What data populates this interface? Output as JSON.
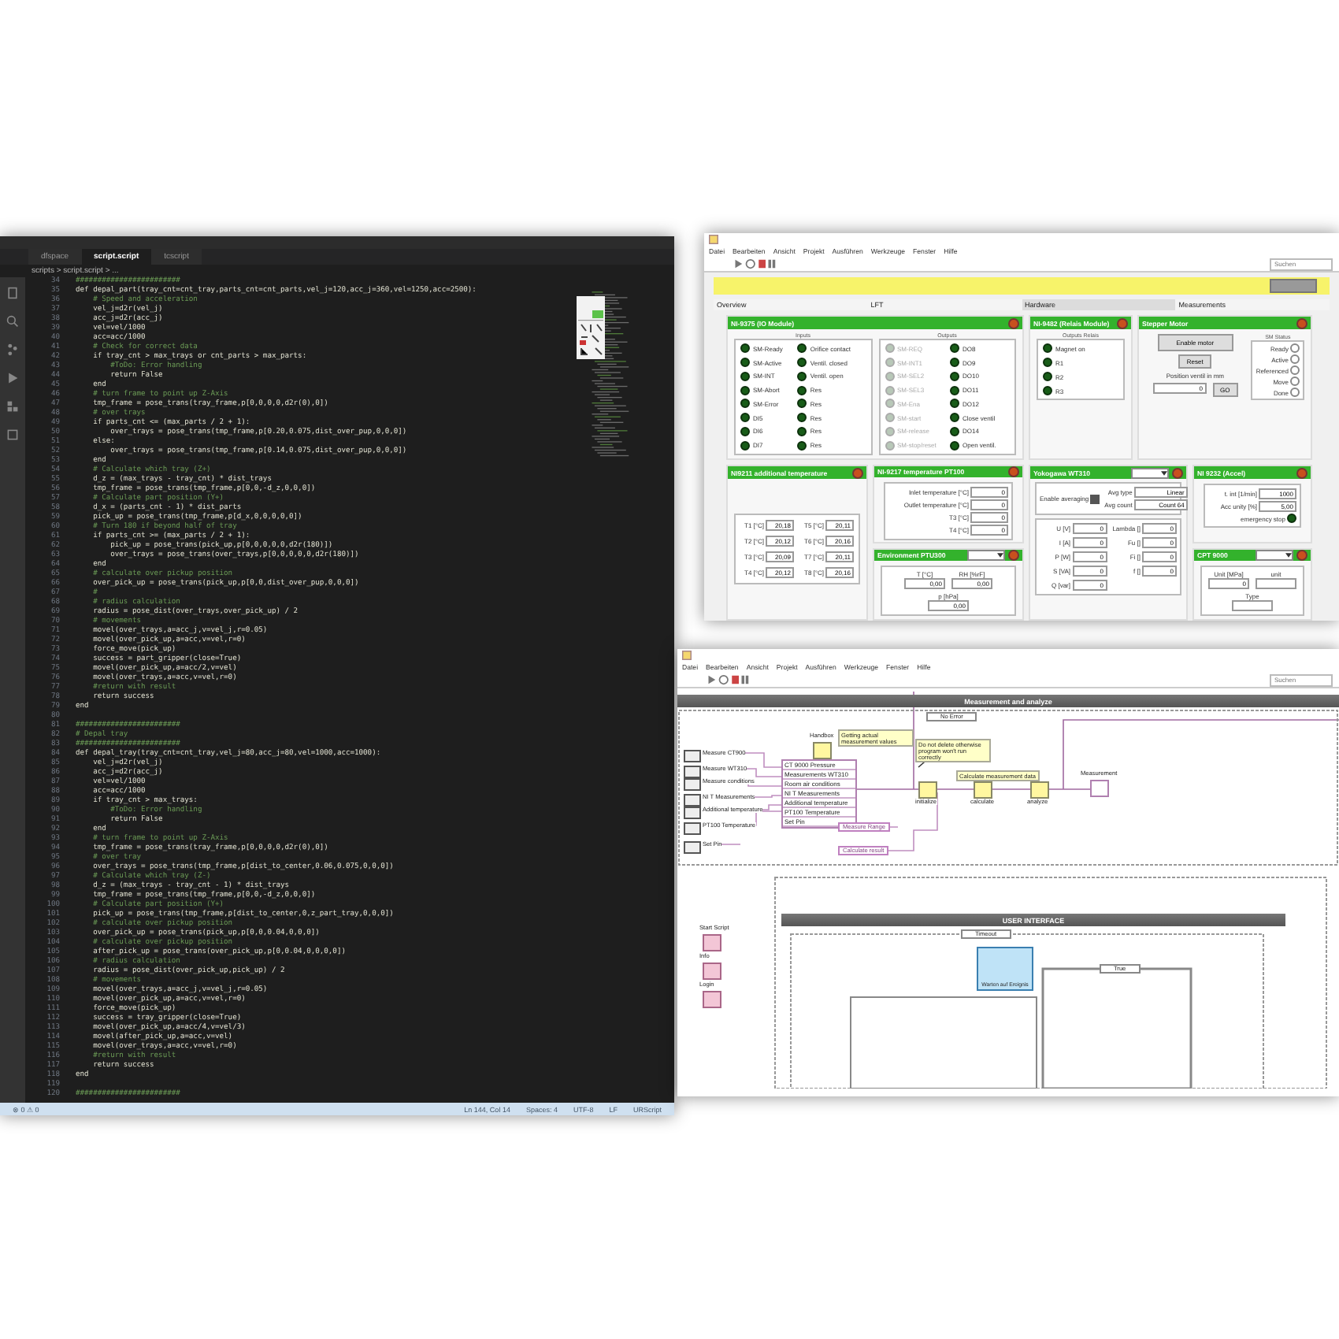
{
  "editor": {
    "tabs": [
      {
        "label": "dfspace",
        "selected": false
      },
      {
        "label": "script.script",
        "selected": true
      },
      {
        "label": "tcscript",
        "selected": false
      }
    ],
    "breadcrumb": "scripts > script.script > ...",
    "lines": [
      {
        "n": "34",
        "kind": "comment",
        "text": "########################"
      },
      {
        "n": "35",
        "kind": "code",
        "text": "def depal_part(tray_cnt=cnt_tray,parts_cnt=cnt_parts,vel_j=120,acc_j=360,vel=1250,acc=2500):"
      },
      {
        "n": "36",
        "kind": "comment",
        "text": "    # Speed and acceleration"
      },
      {
        "n": "37",
        "kind": "code",
        "text": "    vel_j=d2r(vel_j)"
      },
      {
        "n": "38",
        "kind": "code",
        "text": "    acc_j=d2r(acc_j)"
      },
      {
        "n": "39",
        "kind": "code",
        "text": "    vel=vel/1000"
      },
      {
        "n": "40",
        "kind": "code",
        "text": "    acc=acc/1000"
      },
      {
        "n": "41",
        "kind": "comment",
        "text": "    # Check for correct data"
      },
      {
        "n": "42",
        "kind": "code",
        "text": "    if tray_cnt > max_trays or cnt_parts > max_parts:"
      },
      {
        "n": "43",
        "kind": "comment",
        "text": "        #ToDo: Error handling"
      },
      {
        "n": "44",
        "kind": "code",
        "text": "        return False"
      },
      {
        "n": "45",
        "kind": "code",
        "text": "    end"
      },
      {
        "n": "46",
        "kind": "comment",
        "text": "    # turn frame to point up Z-Axis"
      },
      {
        "n": "47",
        "kind": "code",
        "text": "    tmp_frame = pose_trans(tray_frame,p[0,0,0,0,d2r(0),0])"
      },
      {
        "n": "48",
        "kind": "comment",
        "text": "    # over trays"
      },
      {
        "n": "49",
        "kind": "code",
        "text": "    if parts_cnt <= (max_parts / 2 + 1):"
      },
      {
        "n": "50",
        "kind": "code",
        "text": "        over_trays = pose_trans(tmp_frame,p[0.20,0.075,dist_over_pup,0,0,0])"
      },
      {
        "n": "51",
        "kind": "code",
        "text": "    else:"
      },
      {
        "n": "52",
        "kind": "code",
        "text": "        over_trays = pose_trans(tmp_frame,p[0.14,0.075,dist_over_pup,0,0,0])"
      },
      {
        "n": "53",
        "kind": "code",
        "text": "    end"
      },
      {
        "n": "54",
        "kind": "comment",
        "text": "    # Calculate which tray (Z+)"
      },
      {
        "n": "55",
        "kind": "code",
        "text": "    d_z = (max_trays - tray_cnt) * dist_trays"
      },
      {
        "n": "56",
        "kind": "code",
        "text": "    tmp_frame = pose_trans(tmp_frame,p[0,0,-d_z,0,0,0])"
      },
      {
        "n": "57",
        "kind": "comment",
        "text": "    # Calculate part position (Y+)"
      },
      {
        "n": "58",
        "kind": "code",
        "text": "    d_x = (parts_cnt - 1) * dist_parts"
      },
      {
        "n": "59",
        "kind": "code",
        "text": "    pick_up = pose_trans(tmp_frame,p[d_x,0,0,0,0,0])"
      },
      {
        "n": "60",
        "kind": "comment",
        "text": "    # Turn 180 if beyond half of tray"
      },
      {
        "n": "61",
        "kind": "code",
        "text": "    if parts_cnt >= (max_parts / 2 + 1):"
      },
      {
        "n": "62",
        "kind": "code",
        "text": "        pick_up = pose_trans(pick_up,p[0,0,0,0,0,d2r(180)])"
      },
      {
        "n": "63",
        "kind": "code",
        "text": "        over_trays = pose_trans(over_trays,p[0,0,0,0,0,d2r(180)])"
      },
      {
        "n": "64",
        "kind": "code",
        "text": "    end"
      },
      {
        "n": "65",
        "kind": "comment",
        "text": "    # calculate over pickup position"
      },
      {
        "n": "66",
        "kind": "code",
        "text": "    over_pick_up = pose_trans(pick_up,p[0,0,dist_over_pup,0,0,0])"
      },
      {
        "n": "67",
        "kind": "comment",
        "text": "    #"
      },
      {
        "n": "68",
        "kind": "comment",
        "text": "    # radius calculation"
      },
      {
        "n": "69",
        "kind": "code",
        "text": "    radius = pose_dist(over_trays,over_pick_up) / 2"
      },
      {
        "n": "70",
        "kind": "comment",
        "text": "    # movements"
      },
      {
        "n": "71",
        "kind": "code",
        "text": "    movel(over_trays,a=acc_j,v=vel_j,r=0.05)"
      },
      {
        "n": "72",
        "kind": "code",
        "text": "    movel(over_pick_up,a=acc,v=vel,r=0)"
      },
      {
        "n": "73",
        "kind": "code",
        "text": "    force_move(pick_up)"
      },
      {
        "n": "74",
        "kind": "code",
        "text": "    success = part_gripper(close=True)"
      },
      {
        "n": "75",
        "kind": "code",
        "text": "    movel(over_pick_up,a=acc/2,v=vel)"
      },
      {
        "n": "76",
        "kind": "code",
        "text": "    movel(over_trays,a=acc,v=vel,r=0)"
      },
      {
        "n": "77",
        "kind": "comment",
        "text": "    #return with result"
      },
      {
        "n": "78",
        "kind": "code",
        "text": "    return success"
      },
      {
        "n": "79",
        "kind": "code",
        "text": "end"
      },
      {
        "n": "80",
        "kind": "blank"
      },
      {
        "n": "81",
        "kind": "comment",
        "text": "########################"
      },
      {
        "n": "82",
        "kind": "comment",
        "text": "# Depal tray"
      },
      {
        "n": "83",
        "kind": "comment",
        "text": "########################"
      },
      {
        "n": "84",
        "kind": "code",
        "text": "def depal_tray(tray_cnt=cnt_tray,vel_j=80,acc_j=80,vel=1000,acc=1000):"
      },
      {
        "n": "85",
        "kind": "code",
        "text": "    vel_j=d2r(vel_j)"
      },
      {
        "n": "86",
        "kind": "code",
        "text": "    acc_j=d2r(acc_j)"
      },
      {
        "n": "87",
        "kind": "code",
        "text": "    vel=vel/1000"
      },
      {
        "n": "88",
        "kind": "code",
        "text": "    acc=acc/1000"
      },
      {
        "n": "89",
        "kind": "code",
        "text": "    if tray_cnt > max_trays:"
      },
      {
        "n": "90",
        "kind": "comment",
        "text": "        #ToDo: Error handling"
      },
      {
        "n": "91",
        "kind": "code",
        "text": "        return False"
      },
      {
        "n": "92",
        "kind": "code",
        "text": "    end"
      },
      {
        "n": "93",
        "kind": "comment",
        "text": "    # turn frame to point up Z-Axis"
      },
      {
        "n": "94",
        "kind": "code",
        "text": "    tmp_frame = pose_trans(tray_frame,p[0,0,0,0,d2r(0),0])"
      },
      {
        "n": "95",
        "kind": "comment",
        "text": "    # over tray"
      },
      {
        "n": "96",
        "kind": "code",
        "text": "    over_trays = pose_trans(tmp_frame,p[dist_to_center,0.06,0.075,0,0,0])"
      },
      {
        "n": "97",
        "kind": "comment",
        "text": "    # Calculate which tray (Z-)"
      },
      {
        "n": "98",
        "kind": "code",
        "text": "    d_z = (max_trays - tray_cnt - 1) * dist_trays"
      },
      {
        "n": "99",
        "kind": "code",
        "text": "    tmp_frame = pose_trans(tmp_frame,p[0,0,-d_z,0,0,0])"
      },
      {
        "n": "100",
        "kind": "comment",
        "text": "    # Calculate part position (Y+)"
      },
      {
        "n": "101",
        "kind": "code",
        "text": "    pick_up = pose_trans(tmp_frame,p[dist_to_center,0,z_part_tray,0,0,0])"
      },
      {
        "n": "102",
        "kind": "comment",
        "text": "    # calculate over pickup position"
      },
      {
        "n": "103",
        "kind": "code",
        "text": "    over_pick_up = pose_trans(pick_up,p[0,0,0.04,0,0,0])"
      },
      {
        "n": "104",
        "kind": "comment",
        "text": "    # calculate over pickup position"
      },
      {
        "n": "105",
        "kind": "code",
        "text": "    after_pick_up = pose_trans(over_pick_up,p[0,0.04,0,0,0,0])"
      },
      {
        "n": "106",
        "kind": "comment",
        "text": "    # radius calculation"
      },
      {
        "n": "107",
        "kind": "code",
        "text": "    radius = pose_dist(over_pick_up,pick_up) / 2"
      },
      {
        "n": "108",
        "kind": "comment",
        "text": "    # movements"
      },
      {
        "n": "109",
        "kind": "code",
        "text": "    movel(over_trays,a=acc_j,v=vel_j,r=0.05)"
      },
      {
        "n": "110",
        "kind": "code",
        "text": "    movel(over_pick_up,a=acc,v=vel,r=0)"
      },
      {
        "n": "111",
        "kind": "code",
        "text": "    force_move(pick_up)"
      },
      {
        "n": "112",
        "kind": "code",
        "text": "    success = tray_gripper(close=True)"
      },
      {
        "n": "113",
        "kind": "code",
        "text": "    movel(over_pick_up,a=acc/4,v=vel/3)"
      },
      {
        "n": "114",
        "kind": "code",
        "text": "    movel(after_pick_up,a=acc,v=vel)"
      },
      {
        "n": "115",
        "kind": "code",
        "text": "    movel(over_trays,a=acc,v=vel,r=0)"
      },
      {
        "n": "116",
        "kind": "comment",
        "text": "    #return with result"
      },
      {
        "n": "117",
        "kind": "code",
        "text": "    return success"
      },
      {
        "n": "118",
        "kind": "code",
        "text": "end"
      },
      {
        "n": "119",
        "kind": "blank"
      },
      {
        "n": "120",
        "kind": "comment",
        "text": "########################"
      }
    ],
    "status_bar": {
      "left": [
        "⊗ 0 ⚠ 0"
      ],
      "right": [
        "Ln 144, Col 14",
        "Spaces: 4",
        "UTF-8",
        "LF",
        "URScript"
      ]
    }
  },
  "front_panel": {
    "menu": [
      "Datei",
      "Bearbeiten",
      "Ansicht",
      "Projekt",
      "Ausführen",
      "Werkzeuge",
      "Fenster",
      "Hilfe"
    ],
    "search": {
      "placeholder": "Suchen"
    },
    "tabs": [
      {
        "label": "Overview",
        "selected": false
      },
      {
        "label": "LFT",
        "selected": false
      },
      {
        "label": "Hardware",
        "selected": true
      },
      {
        "label": "Measurements",
        "selected": false
      }
    ],
    "panels": [
      {
        "kind": "io",
        "title": "NI-9375 (IO Module)",
        "groups": [
          {
            "label": "Inputs",
            "items": [
              {
                "label": "SM-Ready",
                "disabled": false
              },
              {
                "label": "SM-Active",
                "disabled": false
              },
              {
                "label": "SM-INT",
                "disabled": false
              },
              {
                "label": "SM-Abort",
                "disabled": false
              },
              {
                "label": "SM-Error",
                "disabled": false
              },
              {
                "label": "DI5",
                "disabled": false
              },
              {
                "label": "DI6",
                "disabled": false
              },
              {
                "label": "DI7",
                "disabled": false
              },
              {
                "label": "Orifice contact",
                "disabled": false
              },
              {
                "label": "Ventil. closed",
                "disabled": false
              },
              {
                "label": "Ventil. open",
                "disabled": false
              },
              {
                "label": "Res",
                "disabled": false
              },
              {
                "label": "Res",
                "disabled": false
              },
              {
                "label": "Res",
                "disabled": false
              },
              {
                "label": "Res",
                "disabled": false
              },
              {
                "label": "Res",
                "disabled": false
              }
            ]
          },
          {
            "label": "Outputs",
            "items": [
              {
                "label": "SM-REQ",
                "disabled": true
              },
              {
                "label": "SM-INT1",
                "disabled": true
              },
              {
                "label": "SM-SEL2",
                "disabled": true
              },
              {
                "label": "SM-SEL3",
                "disabled": true
              },
              {
                "label": "SM-Ena",
                "disabled": true
              },
              {
                "label": "SM-start",
                "disabled": true
              },
              {
                "label": "SM-release",
                "disabled": true
              },
              {
                "label": "SM-stop/reset",
                "disabled": true
              },
              {
                "label": "DO8",
                "disabled": false
              },
              {
                "label": "DO9",
                "disabled": false
              },
              {
                "label": "DO10",
                "disabled": false
              },
              {
                "label": "DO11",
                "disabled": false
              },
              {
                "label": "DO12",
                "disabled": false
              },
              {
                "label": "Close ventil",
                "disabled": false
              },
              {
                "label": "DO14",
                "disabled": false
              },
              {
                "label": "Open ventil.",
                "disabled": false
              }
            ]
          }
        ]
      },
      {
        "kind": "relais",
        "title": "NI-9482 (Relais Module)",
        "group_label": "Outputs Relais",
        "items": [
          "Magnet on",
          "R1",
          "R2",
          "R3"
        ]
      },
      {
        "kind": "stepper",
        "title": "Stepper Motor",
        "enable_button": "Enable motor",
        "reset_button": "Reset",
        "position_label": "Position ventil in mm",
        "position_value": "0",
        "go_button": "GO",
        "status_label": "SM Status",
        "status": [
          "Ready",
          "Active",
          "Referenced",
          "Move",
          "Done"
        ]
      },
      {
        "kind": "grid",
        "title": "NI9211 additional temperature",
        "fields": [
          {
            "label": "T1 [°C]",
            "value": "20,18"
          },
          {
            "label": "T5 [°C]",
            "value": "20,11"
          },
          {
            "label": "T2 [°C]",
            "value": "20,12"
          },
          {
            "label": "T6 [°C]",
            "value": "20,16"
          },
          {
            "label": "T3 [°C]",
            "value": "20,09"
          },
          {
            "label": "T7 [°C]",
            "value": "20,11"
          },
          {
            "label": "T4 [°C]",
            "value": "20,12"
          },
          {
            "label": "T8 [°C]",
            "value": "20,16"
          }
        ]
      },
      {
        "kind": "list",
        "title": "NI-9217 temperature PT100",
        "fields": [
          {
            "label": "Inlet temperature [°C]",
            "value": "0"
          },
          {
            "label": "Outlet temperature [°C]",
            "value": "0"
          },
          {
            "label": "T3 [°C]",
            "value": "0"
          },
          {
            "label": "T4 [°C]",
            "value": "0"
          }
        ]
      },
      {
        "kind": "yoko",
        "title": "Yokogawa WT310",
        "dropdown": true,
        "averaging_label": "Enable averaging",
        "averaging": true,
        "avg_type_label": "Avg type",
        "avg_type": "Linear",
        "avg_count_label": "Avg count",
        "avg_count": "Count 64",
        "fields": [
          {
            "label": "U [V]",
            "value": "0"
          },
          {
            "label": "Lambda []",
            "value": "0"
          },
          {
            "label": "I [A]",
            "value": "0"
          },
          {
            "label": "Fu []",
            "value": "0"
          },
          {
            "label": "P [W]",
            "value": "0"
          },
          {
            "label": "Fi []",
            "value": "0"
          },
          {
            "label": "S [VA]",
            "value": "0"
          },
          {
            "label": "f []",
            "value": "0"
          },
          {
            "label": "Q [var]",
            "value": "0"
          }
        ]
      },
      {
        "kind": "accel",
        "title": "NI 9232 (Accel)",
        "fields": [
          {
            "label": "t. int [1/min]",
            "value": "1000"
          },
          {
            "label": "Acc unity [%]",
            "value": "5,00"
          }
        ],
        "led_label": "emergency stop"
      },
      {
        "kind": "row",
        "title": "Environment PTU300",
        "dropdown": true,
        "fields": [
          {
            "label": "T [°C]",
            "value": "0,00"
          },
          {
            "label": "RH [%rF]",
            "value": "0,00"
          },
          {
            "label": "p [hPa]",
            "value": "0,00"
          }
        ]
      },
      {
        "kind": "row",
        "title": "CPT 9000",
        "dropdown": true,
        "fields": [
          {
            "label": "Unit [MPa]",
            "value": "0"
          },
          {
            "label": "unit"
          },
          {
            "label": "Type"
          }
        ]
      }
    ]
  },
  "block_diagram": {
    "menu": [
      "Datei",
      "Bearbeiten",
      "Ansicht",
      "Projekt",
      "Ausführen",
      "Werkzeuge",
      "Fenster",
      "Hilfe"
    ],
    "search": {
      "placeholder": "Suchen"
    },
    "header": "Measurement and analyze",
    "case_selector": "No Error",
    "controls": [
      "Measure CT900",
      "Measure WT310",
      "Measure conditions",
      "NI T Measurements",
      "Additional temperature",
      "PT100 Temperature",
      "Set Pin"
    ],
    "bundle_items": [
      "CT 9000 Pressure",
      "Measurements WT310",
      "Room air conditions",
      "NI T Measurements",
      "Additional temperature",
      "PT100 Temperature",
      "Set Pin"
    ],
    "comments": [
      "Getting actual measurement values",
      "Do not delete otherwise program won't run correctly",
      "Calculate measurement data"
    ],
    "nodes": [
      "Handbox",
      "initialize",
      "calculate",
      "analyze",
      "Measurement"
    ],
    "references": [
      "Measure Range",
      "Calculate result"
    ],
    "lower_header": "USER INTERFACE",
    "event_selector": "Timeout",
    "event_node": "Warten auf Ereignis",
    "sub_case": "True",
    "side_labels": [
      "Start Script",
      "Info",
      "Login"
    ]
  }
}
